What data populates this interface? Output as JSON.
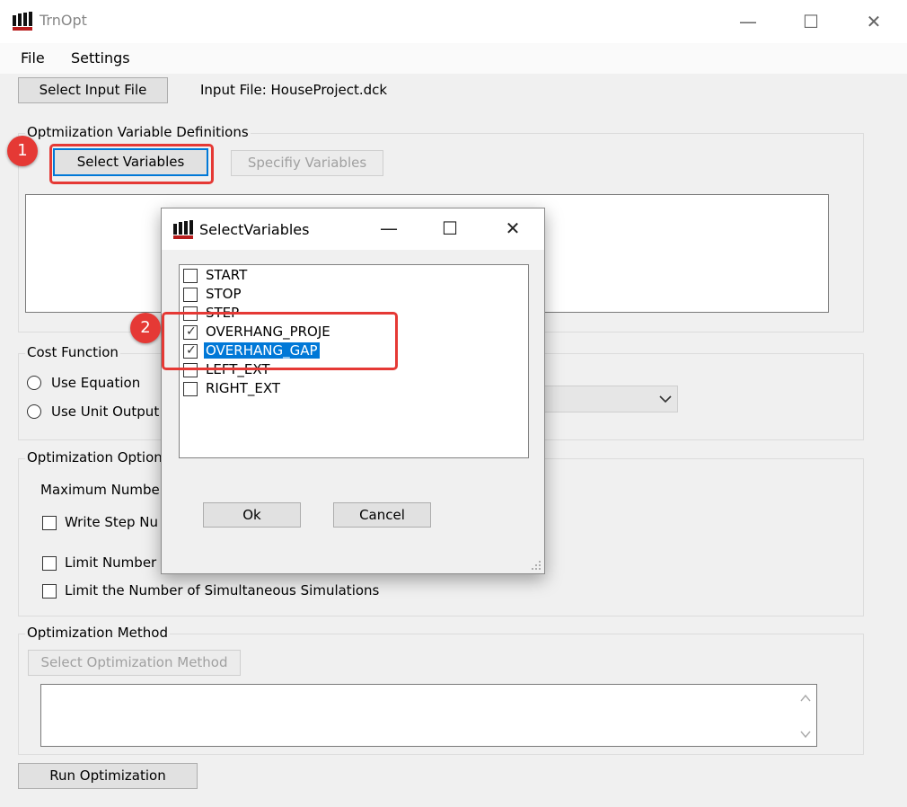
{
  "window": {
    "title": "TrnOpt",
    "controls": [
      "—",
      "☐",
      "✕"
    ]
  },
  "menu": [
    "File",
    "Settings"
  ],
  "input": {
    "button": "Select Input File",
    "label": "Input File: HouseProject.dck"
  },
  "variables_group": {
    "label": "Optmiization Variable Definitions",
    "select_button": "Select Variables",
    "specify_button": "Specifiy Variables"
  },
  "cost_group": {
    "label": "Cost Function",
    "opt_equation": "Use Equation",
    "opt_unit": "Use Unit Output"
  },
  "options_group": {
    "label": "Optimization Option",
    "max_label": "Maximum Number",
    "write_step": "Write Step Nu",
    "limit_number": "Limit Number",
    "limit_simul": "Limit the Number of Simultaneous Simulations"
  },
  "method_group": {
    "label": "Optimization Method",
    "select_button": "Select Optimization Method"
  },
  "run_button": "Run Optimization",
  "annotations": [
    "1",
    "2"
  ],
  "dialog": {
    "title": "SelectVariables",
    "controls": [
      "—",
      "☐",
      "✕"
    ],
    "items": [
      {
        "label": "START",
        "checked": false,
        "selected": false
      },
      {
        "label": "STOP",
        "checked": false,
        "selected": false
      },
      {
        "label": "STEP",
        "checked": false,
        "selected": false
      },
      {
        "label": "OVERHANG_PROJE",
        "checked": true,
        "selected": false
      },
      {
        "label": "OVERHANG_GAP",
        "checked": true,
        "selected": true
      },
      {
        "label": "LEFT_EXT",
        "checked": false,
        "selected": false
      },
      {
        "label": "RIGHT_EXT",
        "checked": false,
        "selected": false
      }
    ],
    "ok": "Ok",
    "cancel": "Cancel"
  },
  "colors": {
    "accent": "#0078d7",
    "annotation": "#e53935"
  },
  "icons": {
    "app": "trnsys-bars-icon",
    "combo": "chevron-down-icon",
    "scroll_up": "chevron-up-icon",
    "scroll_down": "chevron-down-icon"
  }
}
